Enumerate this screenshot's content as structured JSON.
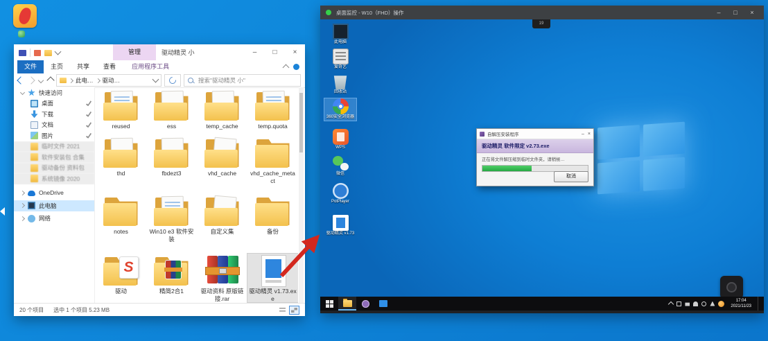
{
  "host": {
    "accent_blue": "#0d83d8"
  },
  "explorer": {
    "title": "驱动精灵 小",
    "window_controls": {
      "minimize": "–",
      "maximize": "□",
      "close": "×"
    },
    "ribbon": {
      "file_tab": "文件",
      "tabs": [
        {
          "label": "主页"
        },
        {
          "label": "共享"
        },
        {
          "label": "查看"
        }
      ],
      "context_header": "管理",
      "context_tab": "应用程序工具"
    },
    "address": {
      "crumbs": [
        {
          "label": "此电…"
        },
        {
          "label": "驱动…"
        }
      ],
      "search_placeholder": "搜索\"驱动精灵 小\""
    },
    "sidebar": {
      "items": [
        {
          "label": "快速访问",
          "icon": "quick-access"
        },
        {
          "label": "桌面",
          "icon": "desktop"
        },
        {
          "label": "下载",
          "icon": "downloads"
        },
        {
          "label": "文档",
          "icon": "documents"
        },
        {
          "label": "图片",
          "icon": "pictures"
        },
        {
          "label": "临时文件 2021",
          "icon": "folder"
        },
        {
          "label": "软件安装包 合集",
          "icon": "folder"
        },
        {
          "label": "驱动备份 资料包",
          "icon": "folder"
        },
        {
          "label": "系统镜像 2020",
          "icon": "folder"
        },
        {
          "label": "OneDrive",
          "icon": "onedrive"
        },
        {
          "label": "此电脑",
          "icon": "this-pc"
        },
        {
          "label": "网络",
          "icon": "network"
        }
      ]
    },
    "grid": {
      "items": [
        {
          "name": "reused",
          "icon": "folder-doc-blue"
        },
        {
          "name": "ess",
          "icon": "folder-doc"
        },
        {
          "name": "temp_cache",
          "icon": "folder-doc"
        },
        {
          "name": "temp.quota",
          "icon": "folder-doc-blue"
        },
        {
          "name": "thd",
          "icon": "folder-doc"
        },
        {
          "name": "fbdezt3",
          "icon": "folder-doc"
        },
        {
          "name": "vhd_cache",
          "icon": "folder-doc-tilt"
        },
        {
          "name": "vhd_cache_meta ct",
          "icon": "folder-plain"
        },
        {
          "name": "notes",
          "icon": "folder-plain"
        },
        {
          "name": "Win10 e3 软件安装",
          "icon": "folder-doc-blue"
        },
        {
          "name": "自定义集",
          "icon": "folder-doc-tilt"
        },
        {
          "name": "备份",
          "icon": "folder-plain"
        },
        {
          "name": "驱动",
          "icon": "app-s",
          "badge": "S"
        },
        {
          "name": "精简2合1",
          "icon": "folder-rar"
        },
        {
          "name": "驱动资料 原版链接.rar",
          "icon": "winrar-archive"
        },
        {
          "name": "驱动精灵 v1.73.exe",
          "icon": "installer-exe"
        }
      ]
    },
    "status": {
      "count": "20 个项目",
      "selection": "选中 1 个项目 5.23 MB"
    }
  },
  "remote": {
    "title": "桌面监控 - W10（FHD）操作",
    "window_controls": {
      "minimize": "–",
      "maximize": "□",
      "close": "×"
    },
    "handle_label": "19",
    "desktop_icons": [
      {
        "label": "此电脑",
        "icon": "this-pc"
      },
      {
        "label": "爱奇艺",
        "icon": "app-box"
      },
      {
        "label": "回收站",
        "icon": "recycle-bin"
      },
      {
        "label": "360安全浏览器",
        "icon": "browser"
      },
      {
        "label": "WPS",
        "icon": "wps"
      },
      {
        "label": "微信",
        "icon": "wechat"
      },
      {
        "label": "PotPlayer",
        "icon": "potplayer"
      },
      {
        "label": "驱动精灵 v1.73",
        "icon": "setup-file"
      }
    ],
    "dialog": {
      "title": "自解压安装程序",
      "minimize": "–",
      "close": "×",
      "header": "驱动精灵 软件限定 v2.73.exe",
      "body": "正在将文件解压缩到临时文件夹，请稍候…",
      "progress_css": "width:47%",
      "cancel": "取消"
    },
    "taskbar": {
      "time": "17:04",
      "date": "2021/11/23"
    }
  }
}
